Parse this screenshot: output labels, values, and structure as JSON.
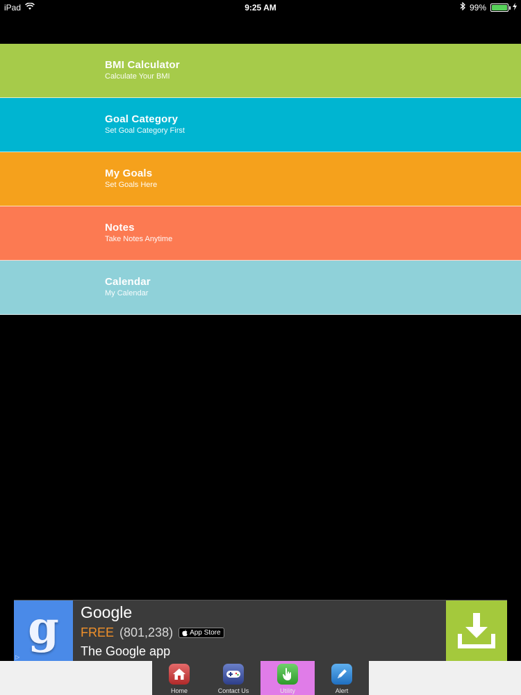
{
  "status_bar": {
    "device": "iPad",
    "time": "9:25 AM",
    "battery": "99%",
    "battery_level": 0.99
  },
  "menu": {
    "items": [
      {
        "title": "BMI Calculator",
        "subtitle": "Calculate Your BMI",
        "color": "#a6cb4a"
      },
      {
        "title": "Goal Category",
        "subtitle": "Set Goal Category First",
        "color": "#00b5d1"
      },
      {
        "title": "My Goals",
        "subtitle": "Set Goals Here",
        "color": "#f5a11c"
      },
      {
        "title": "Notes",
        "subtitle": "Take Notes Anytime",
        "color": "#fc7a52"
      },
      {
        "title": "Calendar",
        "subtitle": "My Calendar",
        "color": "#8fd1d9"
      }
    ]
  },
  "ad": {
    "app_name": "Google",
    "price": "FREE",
    "rating_count": "(801,238)",
    "store_badge": "App Store",
    "description": "The Google app",
    "logo_letter": "g",
    "adchoices_mark": "▷",
    "colors": {
      "logo_bg": "#4a8ae8",
      "download_bg": "#a4c93c",
      "price": "#f0902a"
    }
  },
  "tabbar": {
    "tabs": [
      {
        "label": "Home",
        "icon": "home-icon",
        "active": false
      },
      {
        "label": "Contact Us",
        "icon": "gamepad-icon",
        "active": false
      },
      {
        "label": "Utility",
        "icon": "hand-pointer-icon",
        "active": true
      },
      {
        "label": "Alert",
        "icon": "pen-icon",
        "active": false
      }
    ],
    "active_color": "#e07ce8"
  }
}
